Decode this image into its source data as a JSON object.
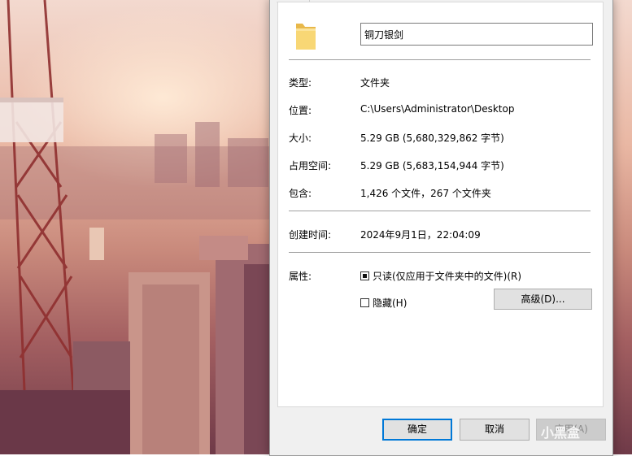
{
  "folder": {
    "name": "铜刀银剑"
  },
  "properties": {
    "type": {
      "label": "类型:",
      "value": "文件夹"
    },
    "location": {
      "label": "位置:",
      "value": "C:\\Users\\Administrator\\Desktop"
    },
    "size": {
      "label": "大小:",
      "value": "5.29 GB (5,680,329,862 字节)"
    },
    "size_on_disk": {
      "label": "占用空间:",
      "value": "5.29 GB (5,683,154,944 字节)"
    },
    "contains": {
      "label": "包含:",
      "value": "1,426 个文件，267 个文件夹"
    },
    "created": {
      "label": "创建时间:",
      "value": "2024年9月1日，22:04:09"
    }
  },
  "attributes": {
    "label": "属性:",
    "readonly": {
      "label": "只读(仅应用于文件夹中的文件)(R)",
      "state": "indeterminate"
    },
    "hidden": {
      "label": "隐藏(H)",
      "state": "unchecked"
    },
    "advanced_button": "高级(D)..."
  },
  "buttons": {
    "ok": "确定",
    "cancel": "取消",
    "apply": "应用(A)"
  },
  "watermark": {
    "text": "小黑盒"
  },
  "colors": {
    "accent": "#0078d7",
    "folder": "#f8d775"
  }
}
